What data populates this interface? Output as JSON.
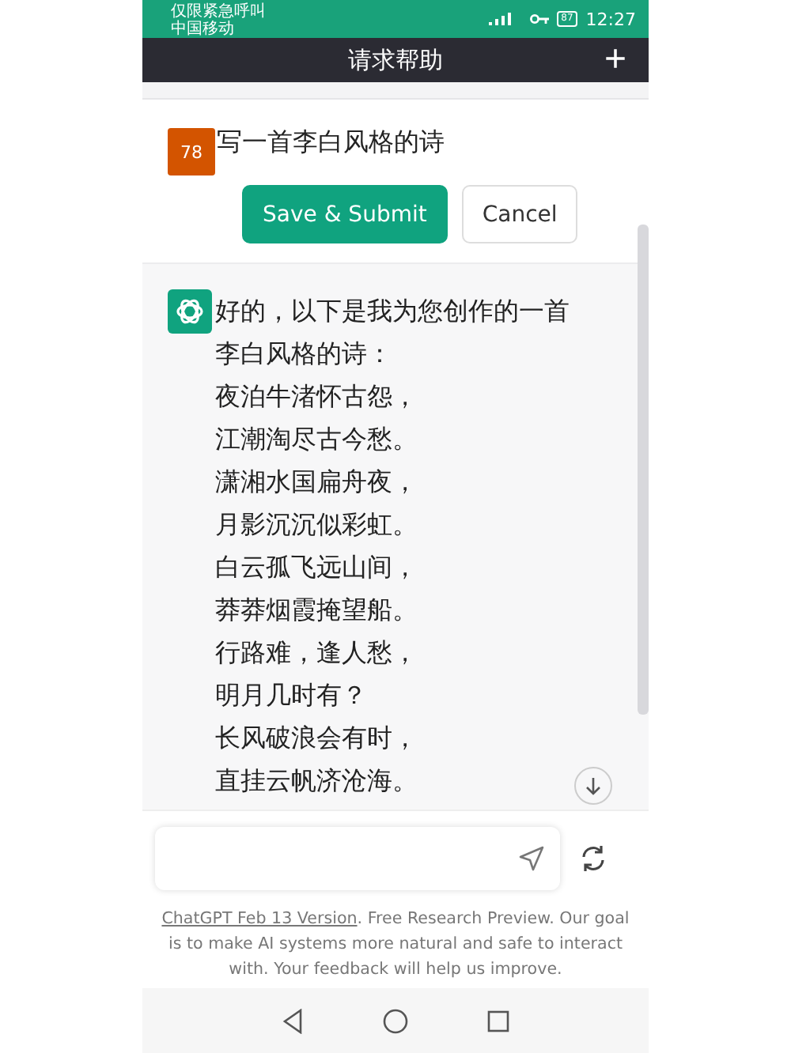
{
  "status_bar": {
    "carrier_line_1": "仅限紧急呼叫",
    "carrier_line_2": "中国移动",
    "battery": "87",
    "time": "12:27"
  },
  "header": {
    "title": "请求帮助",
    "add_button": "+"
  },
  "user_message": {
    "avatar": "78",
    "text": "写一首李白风格的诗",
    "buttons": [
      {
        "label": "Save & Submit",
        "kind": "primary"
      },
      {
        "label": "Cancel",
        "kind": "secondary"
      }
    ]
  },
  "assistant_message": {
    "intro": "好的，以下是我为您创作的一首李白风格的诗：",
    "lines": [
      "夜泊牛渚怀古怨，",
      "江潮淘尽古今愁。",
      "潇湘水国扁舟夜，",
      "月影沉沉似彩虹。",
      "白云孤飞远山间，",
      "莽莽烟霞掩望船。",
      "行路难，逢人愁，",
      "明月几时有？",
      "长风破浪会有时，",
      "直挂云帆济沧海。"
    ]
  },
  "footer": {
    "link": "ChatGPT Feb 13 Version",
    "text": ". Free Research Preview. Our goal is to make AI systems more natural and safe to interact with. Your feedback will help us improve."
  }
}
